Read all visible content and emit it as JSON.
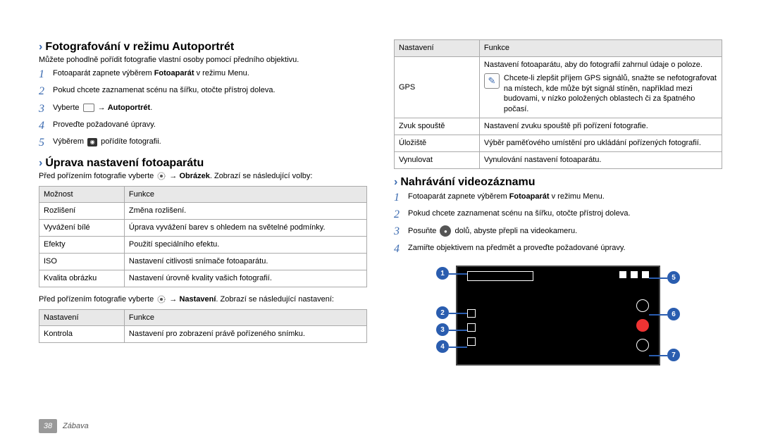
{
  "left": {
    "sec1": {
      "title": "Fotografování v režimu Autoportrét",
      "desc": "Můžete pohodlně pořídit fotografie vlastní osoby pomocí předního objektivu.",
      "steps": {
        "s1a": "Fotoaparát zapnete výběrem ",
        "s1b": "Fotoaparát",
        "s1c": " v režimu Menu.",
        "s2": "Pokud chcete zaznamenat scénu na šířku, otočte přístroj doleva.",
        "s3a": "Vyberte ",
        "s3b": " → ",
        "s3c": "Autoportrét",
        "s3d": ".",
        "s4": "Proveďte požadované úpravy.",
        "s5a": "Výběrem ",
        "s5b": " pořídíte fotografii."
      }
    },
    "sec2": {
      "title": "Úprava nastavení fotoaparátu",
      "desc_a": "Před pořízením fotografie vyberte ",
      "desc_b": " → ",
      "desc_c": "Obrázek",
      "desc_d": ". Zobrazí se následující volby:",
      "table1": {
        "h1": "Možnost",
        "h2": "Funkce",
        "r1c1": "Rozlišení",
        "r1c2": "Změna rozlišení.",
        "r2c1": "Vyvážení bílé",
        "r2c2": "Úprava vyvážení barev s ohledem na světelné podmínky.",
        "r3c1": "Efekty",
        "r3c2": "Použití speciálního efektu.",
        "r4c1": "ISO",
        "r4c2": "Nastavení citlivosti snímače fotoaparátu.",
        "r5c1": "Kvalita obrázku",
        "r5c2": "Nastavení úrovně kvality vašich fotografií."
      },
      "desc2_a": "Před pořízením fotografie vyberte ",
      "desc2_b": " → ",
      "desc2_c": "Nastavení",
      "desc2_d": ". Zobrazí se následující nastavení:",
      "table2": {
        "h1": "Nastavení",
        "h2": "Funkce",
        "r1c1": "Kontrola",
        "r1c2": "Nastavení pro zobrazení právě pořízeného snímku."
      }
    }
  },
  "right": {
    "table3": {
      "h1": "Nastavení",
      "h2": "Funkce",
      "r1c1": "GPS",
      "r1c2": "Nastavení fotoaparátu, aby do fotografií zahrnul údaje o poloze.",
      "r1note": "Chcete-li zlepšit příjem GPS signálů, snažte se nefotografovat na místech, kde může být signál stíněn, například mezi budovami, v nízko položených oblastech či za špatného počasí.",
      "r2c1": "Zvuk spouště",
      "r2c2": "Nastavení zvuku spouště při pořízení fotografie.",
      "r3c1": "Úložiště",
      "r3c2": "Výběr paměťového umístění pro ukládání pořízených fotografií.",
      "r4c1": "Vynulovat",
      "r4c2": "Vynulování nastavení fotoaparátu."
    },
    "sec3": {
      "title": "Nahrávání videozáznamu",
      "steps": {
        "s1a": "Fotoaparát zapnete výběrem ",
        "s1b": "Fotoaparát",
        "s1c": " v režimu Menu.",
        "s2": "Pokud chcete zaznamenat scénu na šířku, otočte přístroj doleva.",
        "s3a": "Posuňte ",
        "s3b": " dolů, abyste přepli na videokameru.",
        "s4": "Zamiřte objektivem na předmět a proveďte požadované úpravy."
      }
    }
  },
  "footer": {
    "page": "38",
    "section": "Zábava"
  }
}
